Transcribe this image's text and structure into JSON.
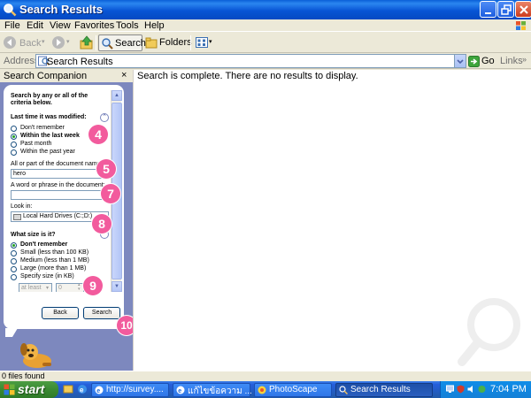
{
  "window": {
    "title": "Search Results"
  },
  "menu": [
    "File",
    "Edit",
    "View",
    "Favorites",
    "Tools",
    "Help"
  ],
  "toolbar": {
    "back": "Back",
    "search": "Search",
    "folders": "Folders"
  },
  "address": {
    "label": "Address",
    "value": "Search Results",
    "go": "Go",
    "links": "Links"
  },
  "companion": {
    "title": "Search Companion",
    "intro": "Search by any or all of the criteria below.",
    "time_heading": "Last time it was modified:",
    "time_options": [
      "Don't remember",
      "Within the last week",
      "Past month",
      "Within the past year"
    ],
    "time_selected": "Within the last week",
    "name_label": "All or part of the document name:",
    "name_value": "hero",
    "phrase_label": "A word or phrase in the document:",
    "phrase_value": "",
    "lookin_label": "Look in:",
    "lookin_value": "Local Hard Drives (C:;D:)",
    "size_heading": "What size is it?",
    "size_options": [
      "Don't remember",
      "Small (less than 100 KB)",
      "Medium (less than 1 MB)",
      "Large (more than 1 MB)",
      "Specify size (in KB)"
    ],
    "size_selected": "Don't remember",
    "size_qualifier": "at least",
    "size_value": "0",
    "back_button": "Back",
    "search_button": "Search"
  },
  "markers": [
    "4",
    "5",
    "7",
    "8",
    "9",
    "10"
  ],
  "main": {
    "message": "Search is complete. There are no results to display."
  },
  "status": {
    "text": "0 files found"
  },
  "taskbar": {
    "start": "start",
    "tasks": [
      "http://survey....",
      "แก้ไขข้อความ ...",
      "PhotoScape",
      "Search Results"
    ],
    "active_task": "Search Results",
    "clock": "7:04 PM"
  },
  "colors": {
    "title_blue": "#0855d5",
    "companion_bg": "#7d88be",
    "marker_pink": "#f25b9d",
    "start_green": "#3a8a32"
  }
}
